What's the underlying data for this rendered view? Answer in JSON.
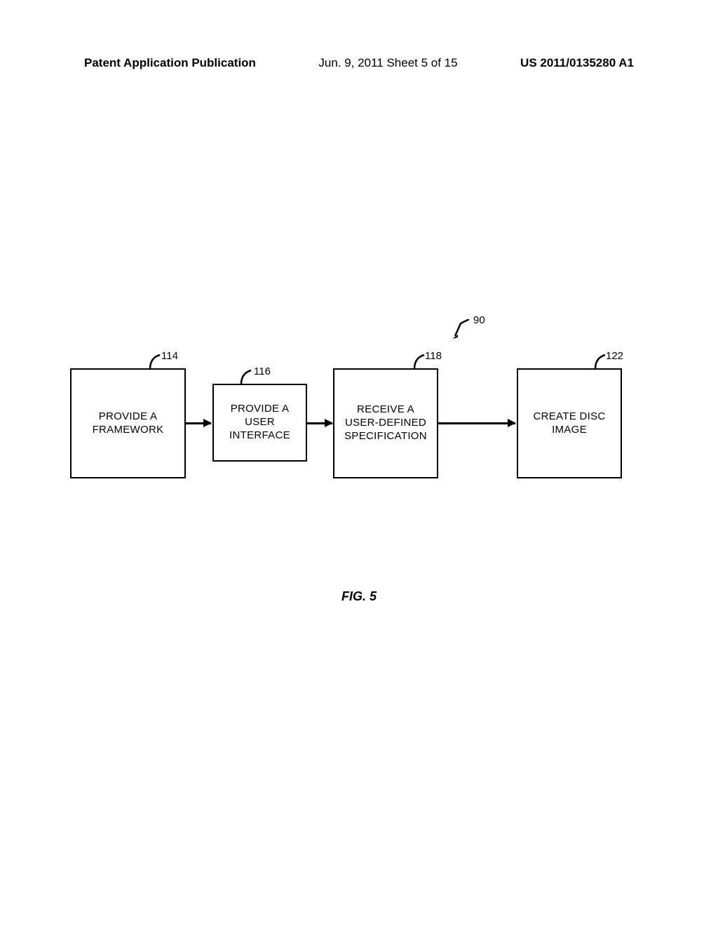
{
  "header": {
    "left": "Patent Application Publication",
    "center": "Jun. 9, 2011  Sheet 5 of 15",
    "right": "US 2011/0135280 A1"
  },
  "diagram": {
    "top_right_ref": "90",
    "boxes": [
      {
        "ref": "114",
        "lines": [
          "PROVIDE A",
          "FRAMEWORK"
        ]
      },
      {
        "ref": "116",
        "lines": [
          "PROVIDE A USER",
          "INTERFACE"
        ]
      },
      {
        "ref": "118",
        "lines": [
          "RECEIVE A",
          "USER-DEFINED",
          "SPECIFICATION"
        ]
      },
      {
        "ref": "122",
        "lines": [
          "CREATE DISC",
          "IMAGE"
        ]
      }
    ]
  },
  "figure_label": "FIG. 5"
}
